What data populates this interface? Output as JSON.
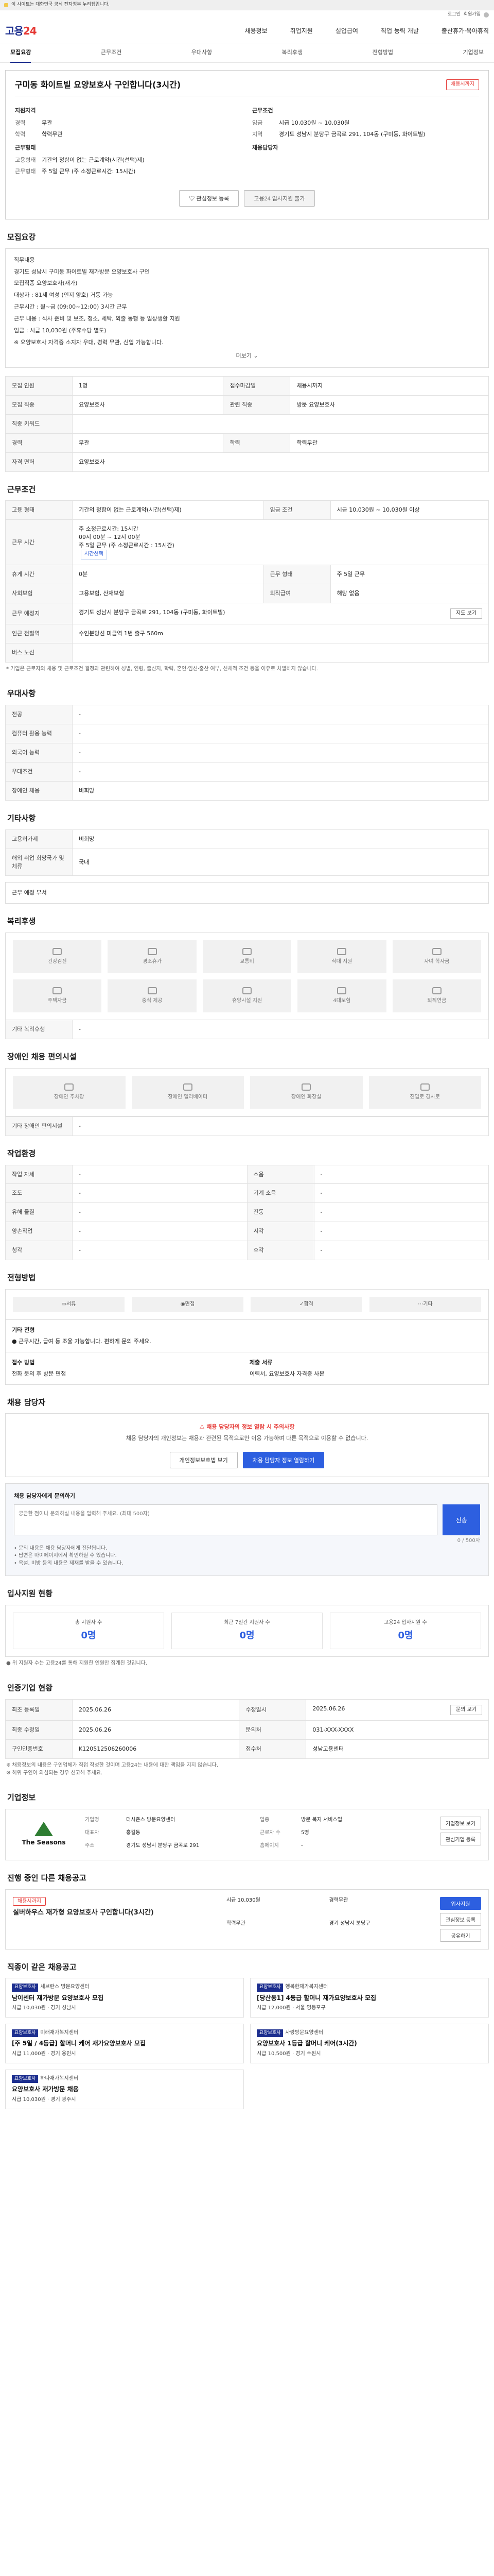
{
  "top_notice": "이 사이트는 대한민국 공식 전자정부 누리집입니다.",
  "util": {
    "login": "로그인",
    "signup": "회원가입"
  },
  "logo": {
    "text": "고용24",
    "accent": "24"
  },
  "gnb": [
    "채용정보",
    "취업지원",
    "실업급여",
    "직업 능력 개발",
    "출산휴가·육아휴직"
  ],
  "tabs": [
    "모집요강",
    "근무조건",
    "우대사항",
    "복리후생",
    "전형방법",
    "기업정보"
  ],
  "hero": {
    "title": "구미동 화이트빌 요양보호사 구인합니다(3시간)",
    "badge": "채용시까지",
    "left_title": "지원자격",
    "left": [
      [
        "경력",
        "무관"
      ],
      [
        "학력",
        "학력무관"
      ]
    ],
    "left2_title": "근무형태",
    "left2": [
      [
        "고용형태",
        "기간의 정함이 없는 근로계약(시간(선택)제)"
      ],
      [
        "근무형태",
        "주 5일 근무 (주 소정근로시간: 15시간)"
      ]
    ],
    "right_title": "근무조건",
    "right": [
      [
        "임금",
        "시급 10,030원 ~ 10,030원"
      ],
      [
        "지역",
        "경기도 성남시 분당구 금곡로 291, 104동 (구미동, 화이트빌)"
      ]
    ],
    "right2_title": "채용담당자"
  },
  "btns": {
    "scrap": "관심정보 등록",
    "apply": "고용24 입사지원 불가"
  },
  "recruit": {
    "title": "모집요강",
    "lines": [
      "직무내용",
      "경기도 성남시 구미동 화이트빌 재가방문 요양보호사 구인",
      "모집직종 요양보호사(재가)",
      "대상자 : 81세 여성 (인지 양호) 거동 가능",
      "근무시간 : 월~금 (09:00~12:00) 3시간 근무",
      "근무 내용 : 식사 준비 및 보조, 청소, 세탁, 외출 동행 등 일상생활 지원",
      "임금 : 시급 10,030원 (주휴수당 별도)",
      "※ 요양보호사 자격증 소지자 우대, 경력 무관, 신입 가능합니다."
    ],
    "more": "더보기"
  },
  "recruit_table": [
    [
      "모집 인원",
      "1명",
      "접수마감일",
      "채용시까지"
    ],
    [
      "모집 직종",
      "요양보호사",
      "관련 직종",
      "방문 요양보호사"
    ],
    [
      "직종 키워드",
      "",
      "",
      ""
    ],
    [
      "경력",
      "무관",
      "학력",
      "학력무관"
    ],
    [
      "자격 면허",
      "요양보호사",
      "",
      ""
    ]
  ],
  "cond": {
    "title": "근무조건",
    "rows": [
      [
        "고용 형태",
        "기간의 정함이 없는 근로계약(시간(선택)제)",
        "임금 조건",
        "시급 10,030원 ~ 10,030원 이상"
      ],
      [
        "근무 시간",
        "주 소정근로시간: 15시간",
        "",
        ""
      ],
      [
        "",
        "09시 00분 ~ 12시 00분",
        "",
        ""
      ],
      [
        "",
        "주 5일 근무 (주 소정근로시간 : 15시간)",
        "",
        ""
      ],
      [
        "휴게 시간",
        "0분",
        "근무 형태",
        "주 5일 근무"
      ],
      [
        "사회보험",
        "고용보험, 산재보험",
        "퇴직급여",
        "해당 없음"
      ],
      [
        "근무 예정지",
        "경기도 성남시 분당구 금곡로 291, 104동 (구미동, 화이트빌)",
        "",
        ""
      ],
      [
        "인근 전철역",
        "수인분당선 미금역 1번 출구 560m",
        "",
        ""
      ],
      [
        "버스 노선",
        "",
        "",
        ""
      ]
    ],
    "tag": "시간선택",
    "map_btn": "지도 보기",
    "note": "* 기업은 근로자의 채용 및 근로조건 결정과 관련하여 성별, 연령, 출신지, 학력, 혼인·임신·출산 여부, 신체적 조건 등을 이유로 차별하지 않습니다."
  },
  "pref": {
    "title": "우대사항",
    "rows": [
      [
        "전공",
        "-"
      ],
      [
        "컴퓨터 활용 능력",
        "-"
      ],
      [
        "외국어 능력",
        "-"
      ],
      [
        "우대조건",
        "-"
      ],
      [
        "장애인 채용",
        "비희망"
      ]
    ]
  },
  "etc": {
    "title": "기타사항",
    "rows": [
      [
        "고용허가제",
        "비희망"
      ],
      [
        "해외 취업 희망국가 및 체류",
        "국내"
      ]
    ]
  },
  "dept_title": "근무 예정 부서",
  "welfare": {
    "title": "복리후생",
    "items": [
      "건강검진",
      "경조휴가",
      "교통비",
      "식대 지원",
      "자녀 학자금",
      "주택자금",
      "중식 제공",
      "휴양시설 지원",
      "4대보험",
      "퇴직연금"
    ],
    "note": "기타 복리후생",
    "note_val": "-"
  },
  "disability": {
    "title": "장애인 채용 편의시설",
    "items": [
      "장애인 주차장",
      "장애인 엘리베이터",
      "장애인 화장실",
      "진입로 경사로"
    ],
    "note": "기타 장애인 편의시설",
    "note_val": "-"
  },
  "work_env": {
    "title": "작업환경",
    "rows": [
      [
        "작업 자세",
        "-",
        "소음",
        "-"
      ],
      [
        "조도",
        "-",
        "기계 소음",
        "-"
      ],
      [
        "유해 물질",
        "-",
        "진동",
        "-"
      ],
      [
        "양손작업",
        "-",
        "시각",
        "-"
      ],
      [
        "청각",
        "-",
        "후각",
        "-"
      ]
    ]
  },
  "hiring": {
    "title": "전형방법",
    "steps": [
      "서류",
      "면접",
      "합격",
      "기타"
    ],
    "method_title": "기타 전형",
    "method": "● 근무시간, 급여 등 조율 가능합니다. 편하게 문의 주세요.",
    "doc_title": "접수 방법",
    "doc": "전화 문의 후 방문 면접",
    "doc2_title": "제출 서류",
    "doc2": "이력서, 요양보호사 자격증 사본"
  },
  "manager": {
    "title": "채용 담당자",
    "notice_title": "채용 담당자의 정보 열람 시 주의사항",
    "notice": "채용 담당자의 개인정보는 채용과 관련된 목적으로만 이용 가능하며 다른 목적으로 이용할 수 없습니다.",
    "btn1": "개인정보보호법 보기",
    "btn2": "채용 담당자 정보 열람하기",
    "qa_title": "채용 담당자에게 문의하기",
    "qa_placeholder": "궁금한 점이나 문의하실 내용을 입력해 주세요. (최대 500자)",
    "qa_count": "0 / 500자",
    "qa_submit": "전송",
    "qa_notes": [
      "• 문의 내용은 채용 담당자에게 전달됩니다.",
      "• 답변은 마이페이지에서 확인하실 수 있습니다.",
      "• 욕설, 비방 등의 내용은 제재를 받을 수 있습니다."
    ]
  },
  "applicant": {
    "title": "입사지원 현황",
    "stats": [
      [
        "총 지원자 수",
        "0명"
      ],
      [
        "최근 7일간 지원자 수",
        "0명"
      ],
      [
        "고용24 입사지원 수",
        "0명"
      ]
    ],
    "note": "● 위 지원자 수는 고용24를 통해 지원한 인원만 집계된 것입니다."
  },
  "history": {
    "title": "인증기업 현황",
    "rows": [
      [
        "최초 등록일",
        "2025.06.26",
        "수정일시",
        "2025.06.26"
      ],
      [
        "최종 수정일",
        "2025.06.26",
        "문의처",
        "031-XXX-XXXX"
      ],
      [
        "구인인증번호",
        "K120512506260006",
        "접수처",
        "성남고용센터"
      ]
    ],
    "btn": "문의 보기",
    "notes": [
      "※ 채용정보의 내용은 구인업체가 직접 작성한 것이며 고용24는 내용에 대한 책임을 지지 않습니다.",
      "※ 허위 구인이 의심되는 경우 신고해 주세요."
    ]
  },
  "company": {
    "title": "기업정보",
    "logo_name": "The Seasons",
    "info": [
      [
        "기업명",
        "더시즌스 방문요양센터",
        "업종",
        "방문 복지 서비스업"
      ],
      [
        "대표자",
        "홍길동",
        "근로자 수",
        "5명"
      ],
      [
        "주소",
        "경기도 성남시 분당구 금곡로 291",
        "홈페이지",
        "-"
      ]
    ],
    "btns": [
      "기업정보 보기",
      "관심기업 등록"
    ]
  },
  "others": {
    "title": "진행 중인 다른 채용공고",
    "lead_badge": "채용시까지",
    "lead_title": "실버하우스 재가형 요양보호사 구인합니다(3시간)",
    "lead_meta": [
      "시급 10,030원",
      "경력무관",
      "학력무관",
      "경기 성남시 분당구"
    ],
    "btns": [
      "입사지원",
      "관심정보 등록",
      "공유하기"
    ]
  },
  "similar": {
    "title": "직종이 같은 채용공고",
    "cards": [
      {
        "cat": "요양보호사",
        "org": "세브란스 방문요양센터",
        "title": "남이센터 재가방문 요양보호사 모집",
        "meta": "시급 10,030원 · 경기 성남시"
      },
      {
        "cat": "요양보호사",
        "org": "행복한재가복지센터",
        "title": "[당산동1] 4등급 할머니 재가요양보호사 모집",
        "meta": "시급 12,000원 · 서울 영등포구"
      },
      {
        "cat": "요양보호사",
        "org": "미래재가복지센터",
        "title": "[주 5일 / 4등급] 할머니 케어 재가요양보호사 모집",
        "meta": "시급 11,000원 · 경기 용인시"
      },
      {
        "cat": "요양보호사",
        "org": "사랑방문요양센터",
        "title": "요양보호사 1등급 할머니 케어(3시간)",
        "meta": "시급 10,500원 · 경기 수원시"
      },
      {
        "cat": "요양보호사",
        "org": "하나재가복지센터",
        "title": "요양보호사 재가방문 채용",
        "meta": "시급 10,030원 · 경기 광주시"
      }
    ]
  }
}
